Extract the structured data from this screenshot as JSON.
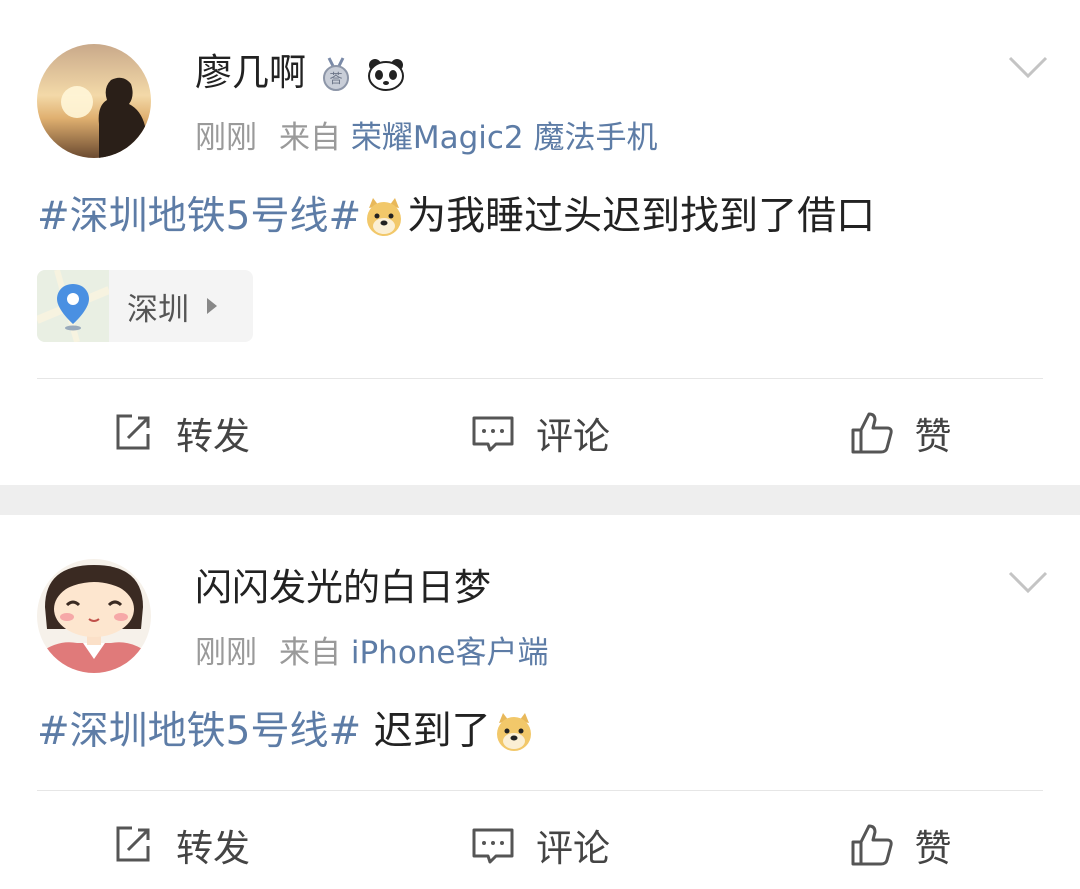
{
  "posts": [
    {
      "username": "廖几啊",
      "time": "刚刚",
      "source_prefix": "来自",
      "source": "荣耀Magic2 魔法手机",
      "topic": "#深圳地铁5号线#",
      "text": "为我睡过头迟到找到了借口",
      "location": "深圳",
      "badges": [
        "medal-badge-icon",
        "panda-badge-icon"
      ],
      "actions": {
        "repost": "转发",
        "comment": "评论",
        "like": "赞"
      }
    },
    {
      "username": "闪闪发光的白日梦",
      "time": "刚刚",
      "source_prefix": "来自",
      "source": "iPhone客户端",
      "topic": "#深圳地铁5号线#",
      "text": " 迟到了",
      "actions": {
        "repost": "转发",
        "comment": "评论",
        "like": "赞"
      }
    }
  ],
  "colors": {
    "link": "#5d7ca6",
    "meta": "#9a9a9a",
    "separator": "#eeeeee"
  }
}
